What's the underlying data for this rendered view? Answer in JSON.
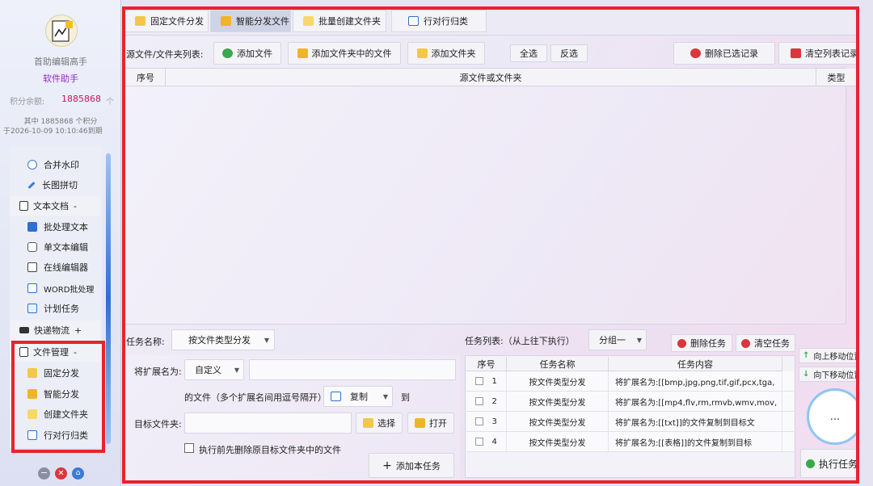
{
  "sidebar": {
    "app_name": "首助编辑高手",
    "app_sub": "软件助手",
    "points_label": "积分余额:",
    "points_value": "1885868",
    "points_unit": "个",
    "points_detail_1": "其中 1885868 个积分",
    "points_detail_2": "于2026-10-09 10:10:46到期",
    "items_top": [
      "合并水印",
      "长图拼切"
    ],
    "group_text": "文本文档",
    "group_text_toggle": "-",
    "items_text": [
      "批处理文本",
      "单文本编辑",
      "在线编辑器",
      "WORD批处理",
      "计划任务"
    ],
    "group_express": "快递物流",
    "group_express_toggle": "+",
    "group_file": "文件管理",
    "group_file_toggle": "-",
    "items_file": [
      "固定分发",
      "智能分发",
      "创建文件夹",
      "行对行归类"
    ]
  },
  "tabs": [
    "固定文件分发",
    "智能分发文件",
    "批量创建文件夹",
    "行对行归类"
  ],
  "toolbar": {
    "label": "源文件/文件夹列表:",
    "add_file": "添加文件",
    "add_in_folder": "添加文件夹中的文件",
    "add_folder": "添加文件夹",
    "select_all": "全选",
    "invert": "反选",
    "delete_selected": "删除已选记录",
    "clear_list": "清空列表记录"
  },
  "source_table": {
    "headers": [
      "序号",
      "源文件或文件夹",
      "类型"
    ]
  },
  "form": {
    "task_name_label": "任务名称:",
    "task_name_value": "按文件类型分发",
    "ext_label": "将扩展名为:",
    "ext_mode": "自定义",
    "ext_hint": "的文件（多个扩展名间用逗号隔开）",
    "action_value": "复制",
    "to_label": "到",
    "target_label": "目标文件夹:",
    "choose_button": "选择",
    "open_button": "打开",
    "delete_first_label": "执行前先删除原目标文件夹中的文件",
    "add_task_button": "添加本任务"
  },
  "tasks": {
    "label": "任务列表:（从上往下执行）",
    "group_value": "分组一",
    "delete_button": "删除任务",
    "clear_button": "清空任务",
    "headers": [
      "序号",
      "任务名称",
      "任务内容"
    ],
    "rows": [
      {
        "no": "1",
        "name": "按文件类型分发",
        "content": "将扩展名为:[[bmp,jpg,png,tif,gif,pcx,tga,"
      },
      {
        "no": "2",
        "name": "按文件类型分发",
        "content": "将扩展名为:[[mp4,flv,rm,rmvb,wmv,mov,"
      },
      {
        "no": "3",
        "name": "按文件类型分发",
        "content": "将扩展名为:[[txt]]的文件复制到目标文"
      },
      {
        "no": "4",
        "name": "按文件类型分发",
        "content": "将扩展名为:[[表格]]的文件复制到目标"
      }
    ],
    "move_up": "向上移动位置",
    "move_down": "向下移动位置",
    "more": "...",
    "execute": "执行任务"
  },
  "colors": {
    "highlight_frame": "#e8232d",
    "points_value": "#c0185e",
    "app_sub": "#8e2bc4"
  }
}
